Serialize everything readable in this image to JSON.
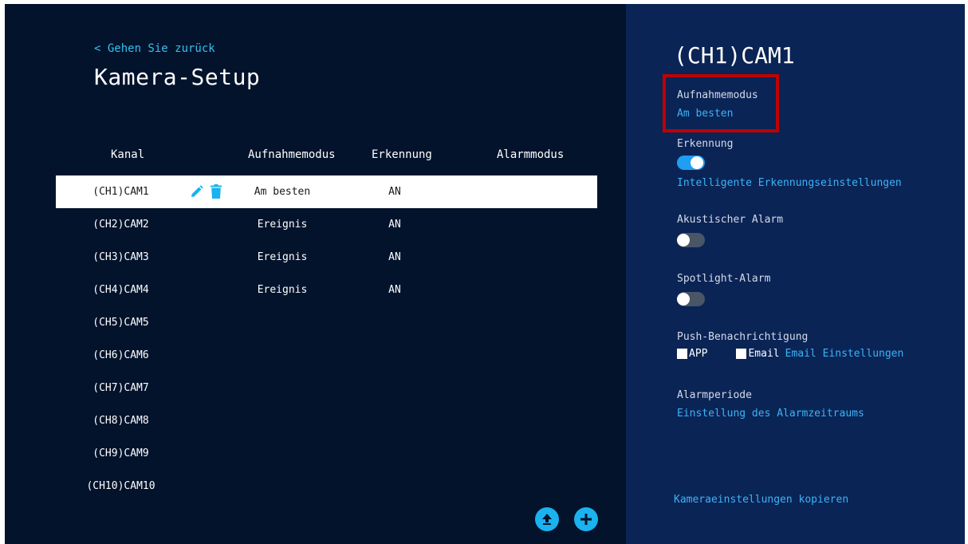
{
  "header": {
    "back_label": "< Gehen Sie zurück",
    "title": "Kamera-Setup"
  },
  "table": {
    "columns": [
      "Kanal",
      "Aufnahmemodus",
      "Erkennung",
      "Alarmmodus"
    ],
    "rows": [
      {
        "channel": "(CH1)CAM1",
        "mode": "Am besten",
        "detection": "AN"
      },
      {
        "channel": "(CH2)CAM2",
        "mode": "Ereignis",
        "detection": "AN"
      },
      {
        "channel": "(CH3)CAM3",
        "mode": "Ereignis",
        "detection": "AN"
      },
      {
        "channel": "(CH4)CAM4",
        "mode": "Ereignis",
        "detection": "AN"
      },
      {
        "channel": "(CH5)CAM5",
        "mode": "",
        "detection": ""
      },
      {
        "channel": "(CH6)CAM6",
        "mode": "",
        "detection": ""
      },
      {
        "channel": "(CH7)CAM7",
        "mode": "",
        "detection": ""
      },
      {
        "channel": "(CH8)CAM8",
        "mode": "",
        "detection": ""
      },
      {
        "channel": "(CH9)CAM9",
        "mode": "",
        "detection": ""
      },
      {
        "channel": "(CH10)CAM10",
        "mode": "",
        "detection": ""
      }
    ],
    "selected_index": 0,
    "row_icons": [
      "edit-icon",
      "delete-icon"
    ]
  },
  "actions": {
    "icons": [
      "upload-icon",
      "add-icon"
    ]
  },
  "details": {
    "camera_title": "(CH1)CAM1",
    "record_mode_label": "Aufnahmemodus",
    "record_mode_value": "Am besten",
    "detection_label": "Erkennung",
    "detection_on": true,
    "detection_link": "Intelligente Erkennungseinstellungen",
    "acoustic_label": "Akustischer Alarm",
    "acoustic_on": false,
    "spotlight_label": "Spotlight-Alarm",
    "spotlight_on": false,
    "push_label": "Push-Benachrichtigung",
    "push_app_label": "APP",
    "push_email_label": "Email",
    "email_settings_link": "Email Einstellungen",
    "alarm_period_label": "Alarmperiode",
    "alarm_period_link": "Einstellung des Alarmzeitraums",
    "copy_link": "Kameraeinstellungen kopieren"
  },
  "colors": {
    "left_bg": "#03132c",
    "right_bg": "#0b2456",
    "accent": "#3ab4f6",
    "fab": "#1ab2ef",
    "toggle_on": "#1e9ff2",
    "highlight": "#c00000"
  }
}
